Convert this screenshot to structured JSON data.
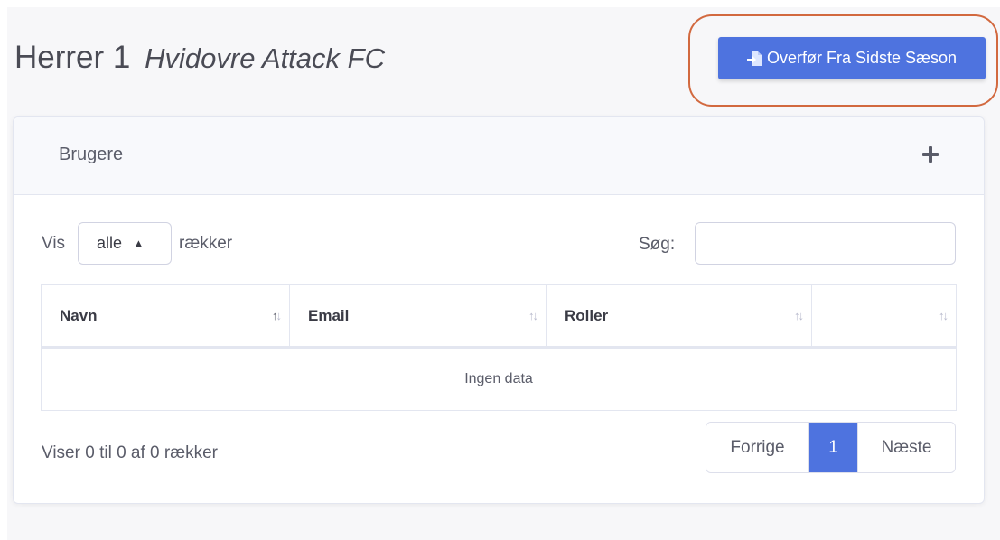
{
  "header": {
    "title": "Herrer 1",
    "subtitle": "Hvidovre Attack FC",
    "transfer_button": "Overfør Fra Sidste Sæson"
  },
  "card": {
    "title": "Brugere",
    "add_icon": "plus-icon"
  },
  "controls": {
    "show_label": "Vis",
    "rows_value": "alle",
    "rows_suffix": "rækker",
    "search_label": "Søg:",
    "search_value": ""
  },
  "table": {
    "columns": [
      "Navn",
      "Email",
      "Roller",
      ""
    ],
    "empty_text": "Ingen data"
  },
  "footer": {
    "info": "Viser 0 til 0 af 0 rækker",
    "prev": "Forrige",
    "current_page": "1",
    "next": "Næste"
  },
  "colors": {
    "primary": "#4e73df",
    "highlight": "#d2693f"
  }
}
